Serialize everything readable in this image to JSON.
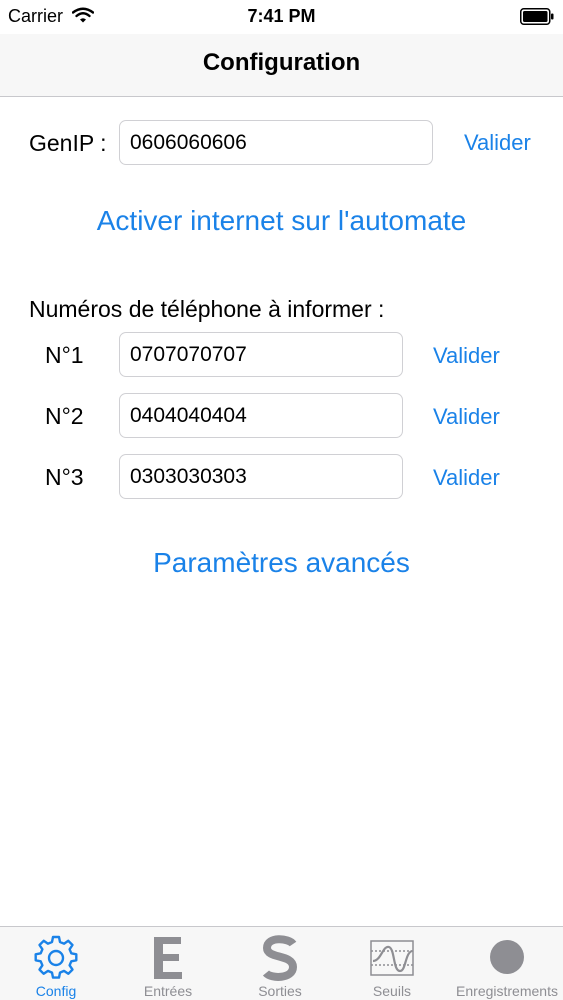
{
  "status_bar": {
    "carrier": "Carrier",
    "time": "7:41 PM"
  },
  "nav": {
    "title": "Configuration"
  },
  "genip": {
    "label": "GenIP :",
    "value": "0606060606",
    "validate": "Valider"
  },
  "activate_internet": "Activer internet sur l'automate",
  "phones": {
    "heading": "Numéros de téléphone à informer :",
    "entries": [
      {
        "label": "N°1",
        "value": "0707070707",
        "validate": "Valider"
      },
      {
        "label": "N°2",
        "value": "0404040404",
        "validate": "Valider"
      },
      {
        "label": "N°3",
        "value": "0303030303",
        "validate": "Valider"
      }
    ]
  },
  "advanced": "Paramètres avancés",
  "tabs": [
    {
      "label": "Config",
      "icon": "gear-icon",
      "active": true
    },
    {
      "label": "Entrées",
      "icon": "letter-e-icon",
      "active": false
    },
    {
      "label": "Sorties",
      "icon": "letter-s-icon",
      "active": false
    },
    {
      "label": "Seuils",
      "icon": "threshold-curve-icon",
      "active": false
    },
    {
      "label": "Enregistrements",
      "icon": "record-circle-icon",
      "active": false
    }
  ],
  "colors": {
    "accent": "#1a82e8",
    "inactive": "#8e8e93",
    "bar": "#f7f7f7"
  }
}
